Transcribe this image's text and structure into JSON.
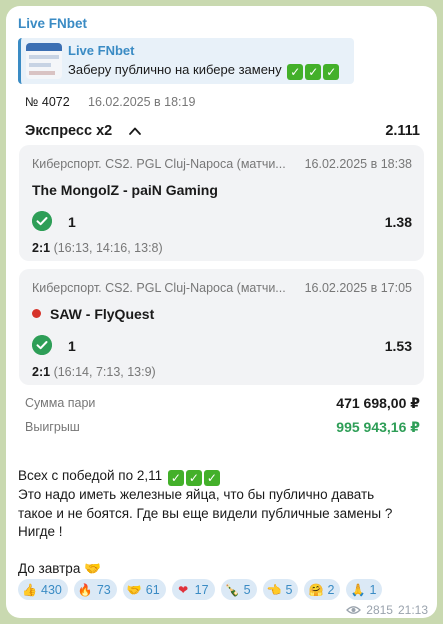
{
  "message": {
    "sender": "Live FNbet",
    "reply": {
      "title": "Live FNbet",
      "text": "Заберу публично на кибере замену"
    },
    "bet": {
      "number": "№ 4072",
      "date": "16.02.2025 в 18:19",
      "title": "Экспресс х2",
      "total_odds": "2.111",
      "events": [
        {
          "league": "Киберспорт. CS2. PGL Cluj-Napoca (матчи...",
          "date": "16.02.2025 в 18:38",
          "teams": "The MongolZ - paiN Gaming",
          "live": false,
          "outcome": "1",
          "odds": "1.38",
          "score_main": "2:1",
          "score_detail": "(16:13, 14:16, 13:8)"
        },
        {
          "league": "Киберспорт. CS2. PGL Cluj-Napoca (матчи...",
          "date": "16.02.2025 в 17:05",
          "teams": "SAW - FlyQuest",
          "live": true,
          "outcome": "1",
          "odds": "1.53",
          "score_main": "2:1",
          "score_detail": "(16:14, 7:13, 13:9)"
        }
      ],
      "stake_label": "Сумма пари",
      "stake_value": "471 698,00 ₽",
      "win_label": "Выигрыш",
      "win_value": "995 943,16 ₽"
    },
    "text_lines": [
      "Всех с победой по 2,11",
      "Это надо иметь железные яйца, что бы публично давать",
      "такое и не боятся. Где вы еще видели публичные замены ?",
      "Нигде !",
      "",
      "До завтра"
    ],
    "reactions": [
      {
        "emoji": "👍",
        "count": "430"
      },
      {
        "emoji": "🔥",
        "count": "73"
      },
      {
        "emoji": "🤝",
        "count": "61"
      },
      {
        "emoji": "❤",
        "count": "17"
      },
      {
        "emoji": "🍾",
        "count": "5"
      },
      {
        "emoji": "👈",
        "count": "5"
      },
      {
        "emoji": "🤗",
        "count": "2"
      },
      {
        "emoji": "🙏",
        "count": "1"
      }
    ],
    "views": "2815",
    "time": "21:13",
    "colors": {
      "accent": "#3a8bc4",
      "win_green": "#2e9e57",
      "live_red": "#d6332a",
      "chat_bg": "#c9d9b0"
    }
  }
}
